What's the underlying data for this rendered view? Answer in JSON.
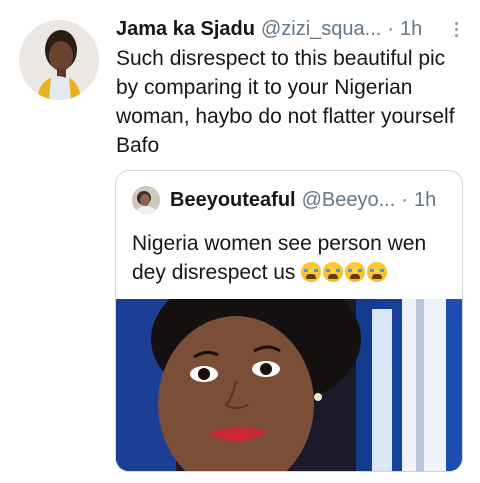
{
  "tweet": {
    "author_name": "Jama ka Sjadu",
    "author_handle": "@zizi_squa...",
    "separator": "·",
    "time": "1h",
    "text": "Such disrespect to this beautiful pic by comparing it to your Nigerian woman, haybo do not flatter yourself Bafo"
  },
  "quoted_tweet": {
    "author_name": "Beeyouteaful",
    "author_handle": "@Beeyo...",
    "separator": "·",
    "time": "1h",
    "text": "Nigeria women see person wen dey disrespect us",
    "emoji_name": "loudly-crying-face",
    "emoji_count": 4
  },
  "icons": {
    "more": "more-vertical-icon",
    "emoji": "loudly-crying-face-icon"
  },
  "colors": {
    "text": "#14171a",
    "secondary": "#657786",
    "border": "#ccd6dd",
    "background": "#ffffff"
  }
}
